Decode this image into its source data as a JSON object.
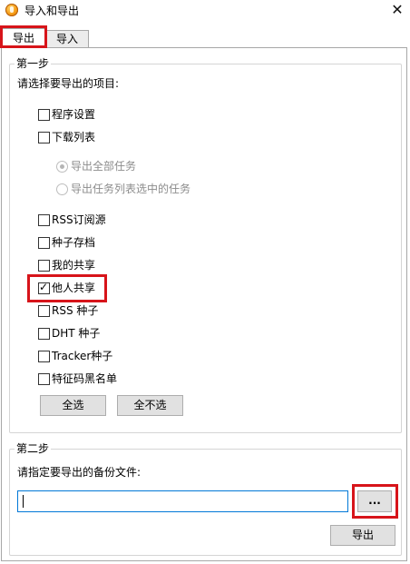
{
  "window": {
    "title": "导入和导出",
    "close_glyph": "✕",
    "app_icon": "thunder-app-icon"
  },
  "tabs": [
    {
      "label": "导出",
      "selected": true
    },
    {
      "label": "导入",
      "selected": false
    }
  ],
  "step1": {
    "legend": "第一步",
    "instruction": "请选择要导出的项目:",
    "items": [
      {
        "label": "程序设置",
        "checked": false
      },
      {
        "label": "下载列表",
        "checked": false
      },
      {
        "label": "RSS订阅源",
        "checked": false
      },
      {
        "label": "种子存档",
        "checked": false
      },
      {
        "label": "我的共享",
        "checked": false
      },
      {
        "label": "他人共享",
        "checked": true
      },
      {
        "label": "RSS 种子",
        "checked": false
      },
      {
        "label": "DHT 种子",
        "checked": false
      },
      {
        "label": "Tracker种子",
        "checked": false
      },
      {
        "label": "特征码黑名单",
        "checked": false
      }
    ],
    "radios": [
      {
        "label": "导出全部任务",
        "selected": true,
        "enabled": false
      },
      {
        "label": "导出任务列表选中的任务",
        "selected": false,
        "enabled": false
      }
    ],
    "select_all_label": "全选",
    "select_none_label": "全不选"
  },
  "step2": {
    "legend": "第二步",
    "instruction": "请指定要导出的备份文件:",
    "path_value": "",
    "browse_label": "...",
    "export_label": "导出"
  },
  "colors": {
    "highlight": "#d7141a",
    "input_focus_border": "#0078d7"
  }
}
